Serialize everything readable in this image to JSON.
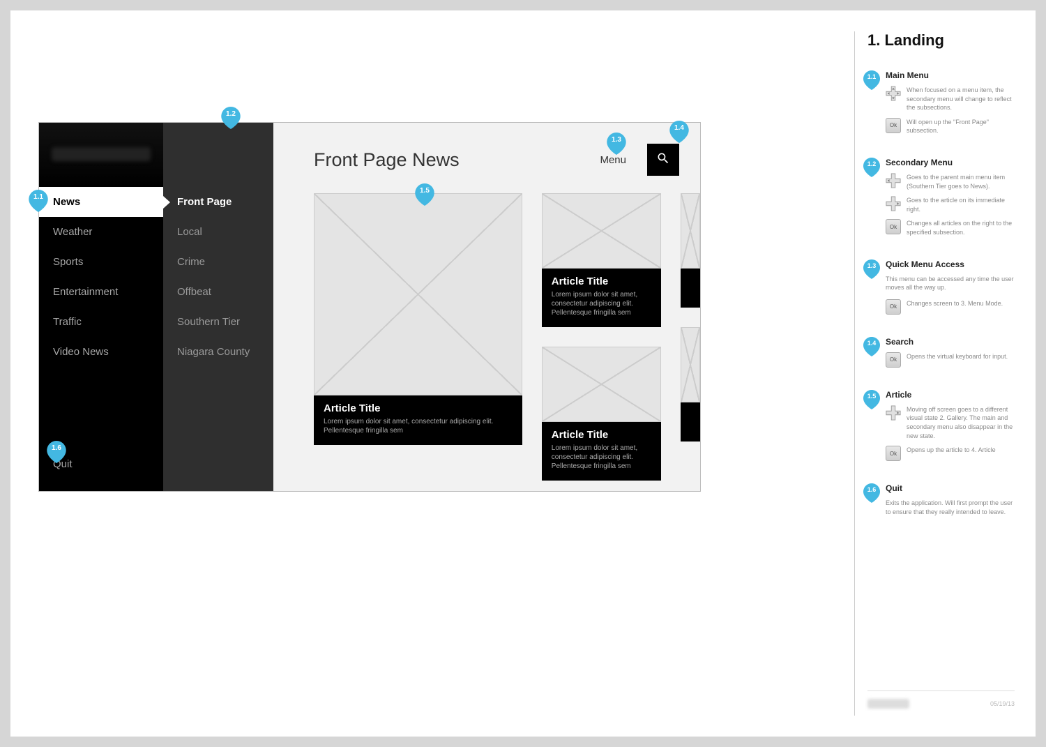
{
  "anno_title": "1. Landing",
  "pins": {
    "p11": "1.1",
    "p12": "1.2",
    "p13": "1.3",
    "p14": "1.4",
    "p15": "1.5",
    "p16": "1.6"
  },
  "main_menu": {
    "items": [
      "News",
      "Weather",
      "Sports",
      "Entertainment",
      "Traffic",
      "Video News"
    ],
    "quit": "Quit"
  },
  "sec_menu": {
    "items": [
      "Front Page",
      "Local",
      "Crime",
      "Offbeat",
      "Southern Tier",
      "Niagara County"
    ]
  },
  "content": {
    "title": "Front Page News",
    "menu_label": "Menu"
  },
  "article": {
    "title": "Article Title",
    "desc": "Lorem ipsum dolor sit amet, consectetur adipiscing elit. Pellentesque fringilla sem"
  },
  "notes": {
    "n1": {
      "num": "1.1",
      "head": "Main Menu",
      "r1": "When focused on a menu item, the secondary menu will change to reflect the subsections.",
      "r2": "Will open up the \"Front Page\" subsection."
    },
    "n2": {
      "num": "1.2",
      "head": "Secondary Menu",
      "r1": "Goes to the parent main menu item (Southern Tier goes to News).",
      "r2": "Goes to the article on its immediate right.",
      "r3": "Changes all articles on the right to the specified subsection."
    },
    "n3": {
      "num": "1.3",
      "head": "Quick Menu Access",
      "r1": "This menu can be accessed any time the user moves all the way up.",
      "r2": "Changes screen to 3. Menu Mode."
    },
    "n4": {
      "num": "1.4",
      "head": "Search",
      "r1": "Opens the virtual keyboard for input."
    },
    "n5": {
      "num": "1.5",
      "head": "Article",
      "r1": "Moving off screen goes to a different visual state 2. Gallery. The main and secondary menu also disappear in the new state.",
      "r2": "Opens up the article to 4. Article"
    },
    "n6": {
      "num": "1.6",
      "head": "Quit",
      "r1": "Exits the application. Will first prompt the user to ensure that they really intended to leave."
    }
  },
  "footer_date": "05/19/13",
  "ok_label": "Ok"
}
